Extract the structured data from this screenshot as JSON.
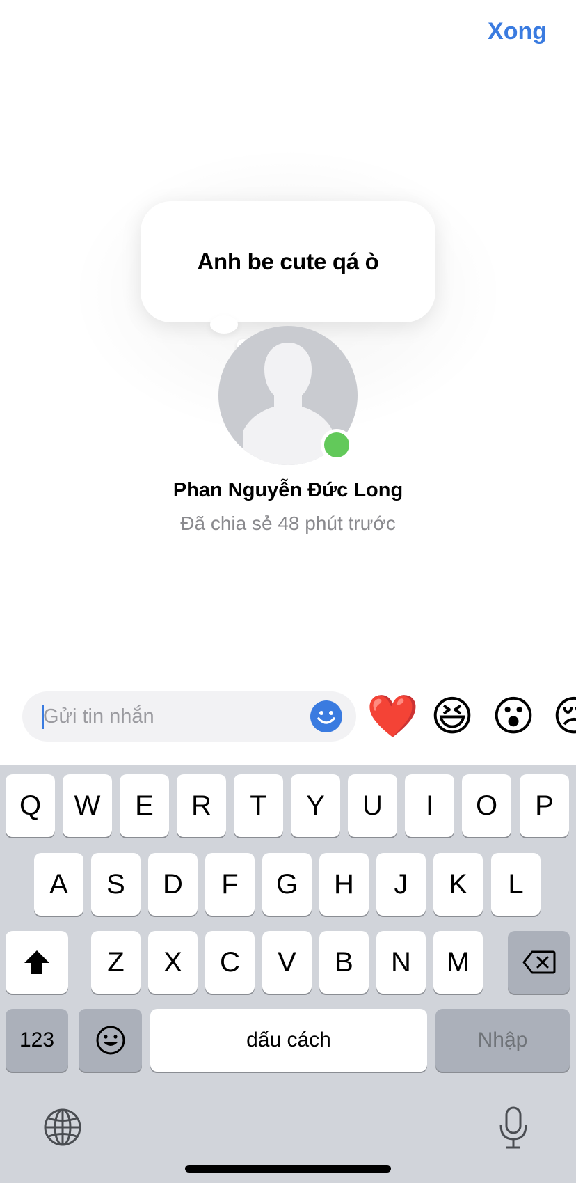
{
  "header": {
    "done_label": "Xong"
  },
  "note": {
    "text": "Anh be cute qá ò",
    "user_name": "Phan Nguyễn Đức Long",
    "shared_time": "Đã chia sẻ 48 phút trước",
    "status": "online",
    "status_color": "#62c95a"
  },
  "reply": {
    "placeholder": "Gửi tin nhắn",
    "quick_reactions": [
      "❤️",
      "😆",
      "😮",
      "😢"
    ]
  },
  "keyboard": {
    "row1": [
      "Q",
      "W",
      "E",
      "R",
      "T",
      "Y",
      "U",
      "I",
      "O",
      "P"
    ],
    "row2": [
      "A",
      "S",
      "D",
      "F",
      "G",
      "H",
      "J",
      "K",
      "L"
    ],
    "row3": [
      "Z",
      "X",
      "C",
      "V",
      "B",
      "N",
      "M"
    ],
    "numbers_label": "123",
    "space_label": "dấu cách",
    "enter_label": "Nhập"
  },
  "colors": {
    "accent": "#3a7be0",
    "keyboard_bg": "#d1d4da",
    "key_dark": "#abb0ba"
  }
}
